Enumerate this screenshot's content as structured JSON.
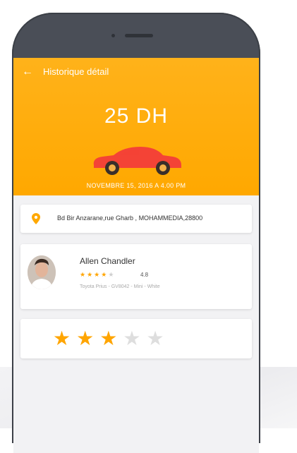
{
  "header": {
    "back_icon": "arrow-left-icon",
    "title": "Historique détail",
    "price": "25 DH",
    "date": "NOVEMBRE 15, 2016 A 4.00 PM",
    "accent_color": "#ffa800",
    "car_color": "#f44336"
  },
  "address": {
    "icon": "location-pin-icon",
    "text": "Bd Bir Anzarane,rue Gharb , MOHAMMEDIA,28800"
  },
  "driver": {
    "name": "Allen Chandler",
    "rating": 4,
    "rating_max": 5,
    "rating_value": "4.8",
    "details": "Toyota Prius - GV8042 - Mini - White"
  },
  "trip_rating": {
    "stars": 3,
    "max": 5
  }
}
